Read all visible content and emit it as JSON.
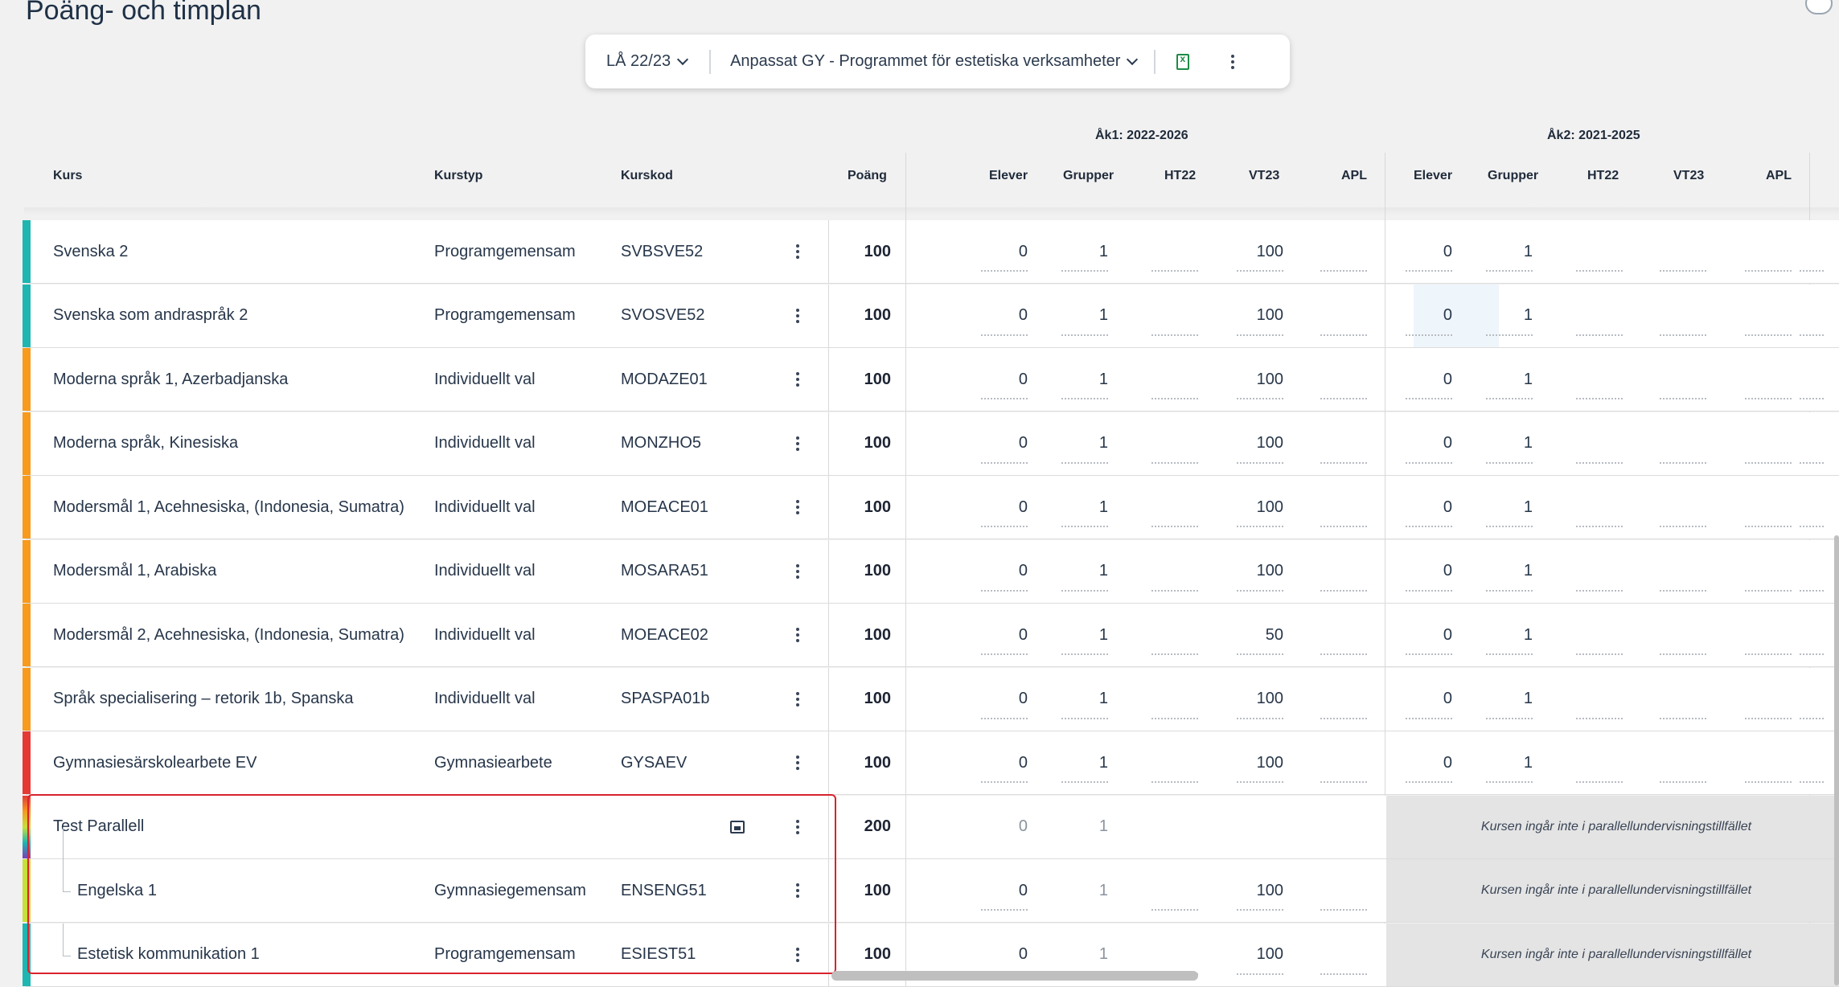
{
  "page": {
    "title": "Poäng- och timplan"
  },
  "toolbar": {
    "year": "LÅ 22/23",
    "program": "Anpassat GY - Programmet för estetiska verksamheter",
    "export_icon": "excel-icon",
    "more_icon": "kebab-icon"
  },
  "header": {
    "groups": [
      "Åk1: 2022-2026",
      "Åk2: 2021-2025"
    ],
    "columns": {
      "kurs": "Kurs",
      "kurstyp": "Kurstyp",
      "kurskod": "Kurskod",
      "poang": "Poäng",
      "elever": "Elever",
      "grupper": "Grupper",
      "ht22": "HT22",
      "vt23": "VT23",
      "apl": "APL"
    }
  },
  "colors": {
    "programgemensam": "#1fb5b0",
    "individuellt": "#f79a1e",
    "gymnasiearbete": "#e53935",
    "parallel_border": "#d9232d"
  },
  "rows": [
    {
      "kurs": "Svenska 2",
      "kurstyp": "Programgemensam",
      "kurskod": "SVBSVE52",
      "poang": "100",
      "a1_elever": "0",
      "a1_grupper": "1",
      "a1_vt23": "100",
      "a2_elever": "0",
      "a2_grupper": "1",
      "stripe": "#1fb5b0"
    },
    {
      "kurs": "Svenska som andraspråk 2",
      "kurstyp": "Programgemensam",
      "kurskod": "SVOSVE52",
      "poang": "100",
      "a1_elever": "0",
      "a1_grupper": "1",
      "a1_vt23": "100",
      "a2_elever": "0",
      "a2_grupper": "1",
      "stripe": "#1fb5b0"
    },
    {
      "kurs": "Moderna språk 1, Azerbadjanska",
      "kurstyp": "Individuellt val",
      "kurskod": "MODAZE01",
      "poang": "100",
      "a1_elever": "0",
      "a1_grupper": "1",
      "a1_vt23": "100",
      "a2_elever": "0",
      "a2_grupper": "1",
      "stripe": "#f79a1e"
    },
    {
      "kurs": "Moderna språk, Kinesiska",
      "kurstyp": "Individuellt val",
      "kurskod": "MONZHO5",
      "poang": "100",
      "a1_elever": "0",
      "a1_grupper": "1",
      "a1_vt23": "100",
      "a2_elever": "0",
      "a2_grupper": "1",
      "stripe": "#f79a1e"
    },
    {
      "kurs": "Modersmål 1, Acehnesiska, (Indonesia, Sumatra)",
      "kurstyp": "Individuellt val",
      "kurskod": "MOEACE01",
      "poang": "100",
      "a1_elever": "0",
      "a1_grupper": "1",
      "a1_vt23": "100",
      "a2_elever": "0",
      "a2_grupper": "1",
      "stripe": "#f79a1e"
    },
    {
      "kurs": "Modersmål 1, Arabiska",
      "kurstyp": "Individuellt val",
      "kurskod": "MOSARA51",
      "poang": "100",
      "a1_elever": "0",
      "a1_grupper": "1",
      "a1_vt23": "100",
      "a2_elever": "0",
      "a2_grupper": "1",
      "stripe": "#f79a1e"
    },
    {
      "kurs": "Modersmål 2, Acehnesiska, (Indonesia, Sumatra)",
      "kurstyp": "Individuellt val",
      "kurskod": "MOEACE02",
      "poang": "100",
      "a1_elever": "0",
      "a1_grupper": "1",
      "a1_vt23": "50",
      "a2_elever": "0",
      "a2_grupper": "1",
      "stripe": "#f79a1e"
    },
    {
      "kurs": "Språk specialisering – retorik 1b, Spanska",
      "kurstyp": "Individuellt val",
      "kurskod": "SPASPA01b",
      "poang": "100",
      "a1_elever": "0",
      "a1_grupper": "1",
      "a1_vt23": "100",
      "a2_elever": "0",
      "a2_grupper": "1",
      "stripe": "#f79a1e"
    },
    {
      "kurs": "Gymnasiesärskolearbete EV",
      "kurstyp": "Gymnasiearbete",
      "kurskod": "GYSAEV",
      "poang": "100",
      "a1_elever": "0",
      "a1_grupper": "1",
      "a1_vt23": "100",
      "a2_elever": "0",
      "a2_grupper": "1",
      "stripe": "#e53935"
    }
  ],
  "parallel": {
    "title": "Test Parallell",
    "poang": "200",
    "a1_elever": "0",
    "a1_grupper": "1",
    "not_included": "Kursen ingår inte i parallellundervisningstillfället",
    "children": [
      {
        "kurs": "Engelska 1",
        "kurstyp": "Gymnasiegemensam",
        "kurskod": "ENSENG51",
        "poang": "100",
        "a1_elever": "0",
        "a1_grupper": "1",
        "a1_vt23": "100",
        "not_included": "Kursen ingår inte i parallellundervisningstillfället",
        "stripe": "#c7e03a"
      },
      {
        "kurs": "Estetisk kommunikation 1",
        "kurstyp": "Programgemensam",
        "kurskod": "ESIEST51",
        "poang": "100",
        "a1_elever": "0",
        "a1_grupper": "1",
        "a1_vt23": "100",
        "not_included": "Kursen ingår inte i parallellundervisningstillfället",
        "stripe": "#1fb5b0"
      }
    ]
  }
}
